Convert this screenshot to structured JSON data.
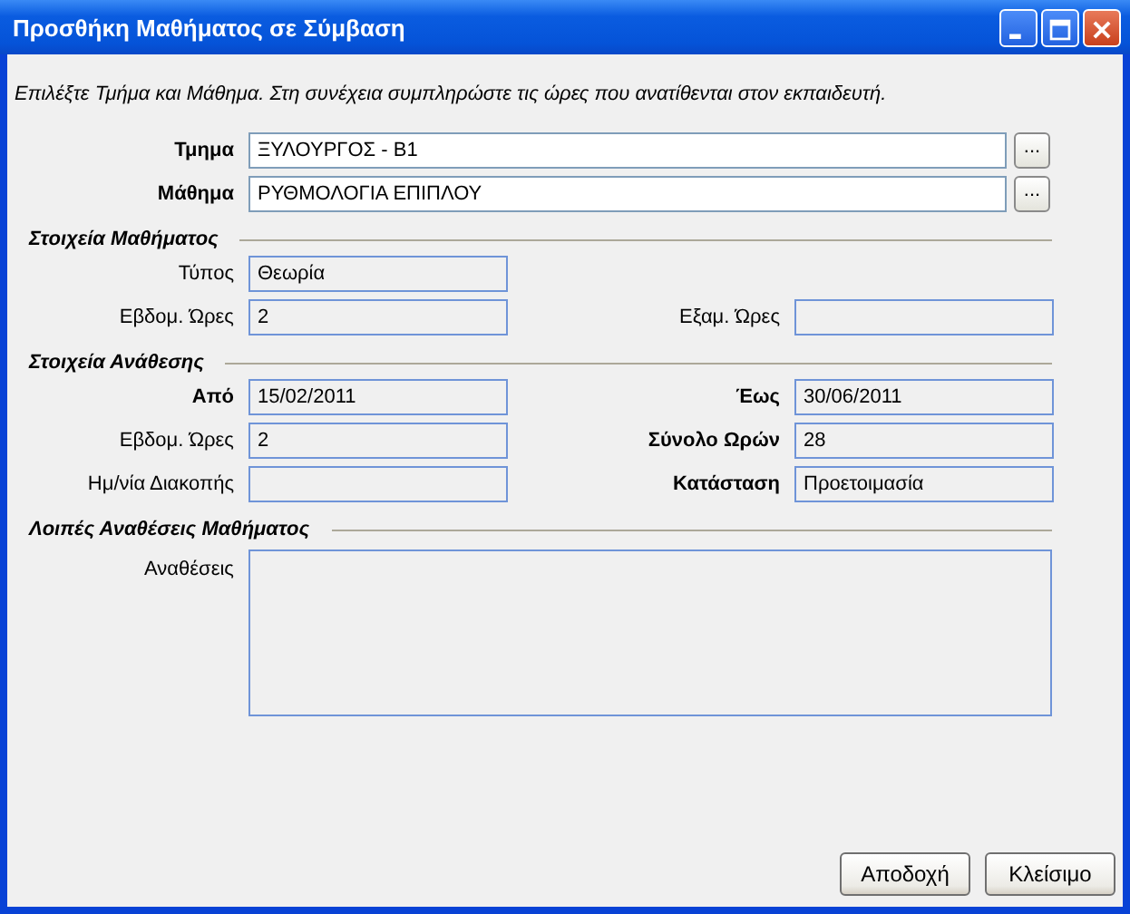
{
  "window": {
    "title": "Προσθήκη Μαθήματος σε Σύμβαση",
    "controls": [
      {
        "kind": "minimize"
      },
      {
        "kind": "maximize"
      },
      {
        "kind": "close"
      }
    ]
  },
  "instruction": "Επιλέξτε Τμήμα και Μάθημα. Στη συνέχεια συμπληρώστε τις ώρες που ανατίθενται στον εκπαιδευτή.",
  "selectors": [
    {
      "label": "Τμημα",
      "value": "ΞΥΛΟΥΡΓΟΣ - Β1",
      "button": "..."
    },
    {
      "label": "Μάθημα",
      "value": "ΡΥΘΜΟΛΟΓΙΑ ΕΠΙΠΛΟΥ",
      "button": "..."
    }
  ],
  "sections": [
    {
      "title": "Στοιχεία Μαθήματος",
      "rows": [
        [
          {
            "label": "Τύπος",
            "bold": false,
            "value": "Θεωρία"
          }
        ],
        [
          {
            "label": "Εβδομ. Ώρες",
            "bold": false,
            "value": "2"
          },
          {
            "label": "Εξαμ. Ώρες",
            "bold": false
          }
        ]
      ]
    },
    {
      "title": "Στοιχεία Ανάθεσης",
      "rows": [
        [
          {
            "label": "Από",
            "bold": true,
            "value": "15/02/2011"
          },
          {
            "label": "Έως",
            "bold": true,
            "value": "30/06/2011"
          }
        ],
        [
          {
            "label": "Εβδομ. Ώρες",
            "bold": false,
            "value": "2"
          },
          {
            "label": "Σύνολο Ωρών",
            "bold": true,
            "value": "28"
          }
        ],
        [
          {
            "label": "Ημ/νία Διακοπής",
            "bold": false
          },
          {
            "label": "Κατάσταση",
            "bold": true,
            "value": "Προετοιμασία"
          }
        ]
      ]
    }
  ],
  "other": {
    "title": "Λοιπές Αναθέσεις Μαθήματος",
    "label": "Αναθέσεις"
  },
  "buttons": [
    "Αποδοχή",
    "Κλείσιμο"
  ]
}
